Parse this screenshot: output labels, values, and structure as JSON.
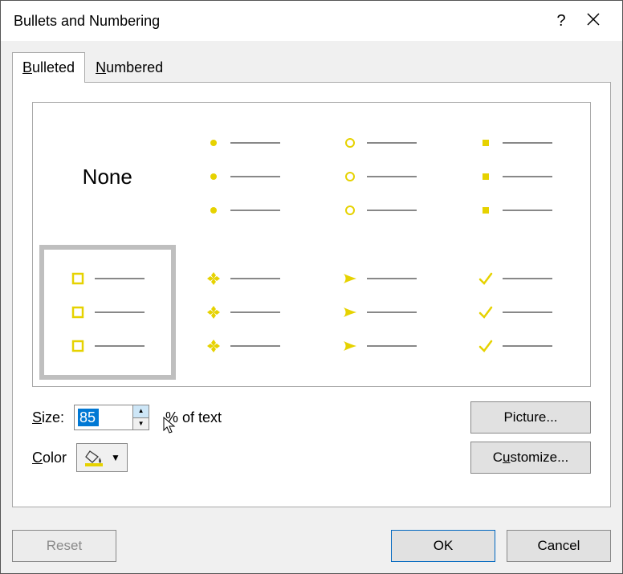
{
  "window": {
    "title": "Bullets and Numbering"
  },
  "tabs": [
    {
      "label": "Bulleted",
      "mnemonic": "B",
      "active": true
    },
    {
      "label": "Numbered",
      "mnemonic": "N",
      "active": false
    }
  ],
  "bullet_styles": {
    "none_label": "None",
    "options": [
      {
        "id": "none",
        "type": "none",
        "selected": false
      },
      {
        "id": "dot-filled",
        "type": "dot-filled",
        "color": "#e6d200",
        "selected": false
      },
      {
        "id": "circle-open",
        "type": "circle-open",
        "color": "#e6d200",
        "selected": false
      },
      {
        "id": "square-filled",
        "type": "square-filled",
        "color": "#e6d200",
        "selected": false
      },
      {
        "id": "square-open",
        "type": "square-open",
        "color": "#e6d200",
        "selected": true
      },
      {
        "id": "diamond-cluster",
        "type": "diamond-cluster",
        "color": "#e6d200",
        "selected": false
      },
      {
        "id": "arrow",
        "type": "arrow",
        "color": "#e6d200",
        "selected": false
      },
      {
        "id": "check",
        "type": "check",
        "color": "#e6d200",
        "selected": false
      }
    ]
  },
  "size": {
    "label": "Size:",
    "mnemonic": "S",
    "value": "85",
    "suffix": "% of text"
  },
  "color": {
    "label": "Color",
    "mnemonic": "C",
    "value": "#e6d200"
  },
  "buttons": {
    "picture": "Picture...",
    "customize": "Customize...",
    "reset": "Reset",
    "ok": "OK",
    "cancel": "Cancel"
  }
}
